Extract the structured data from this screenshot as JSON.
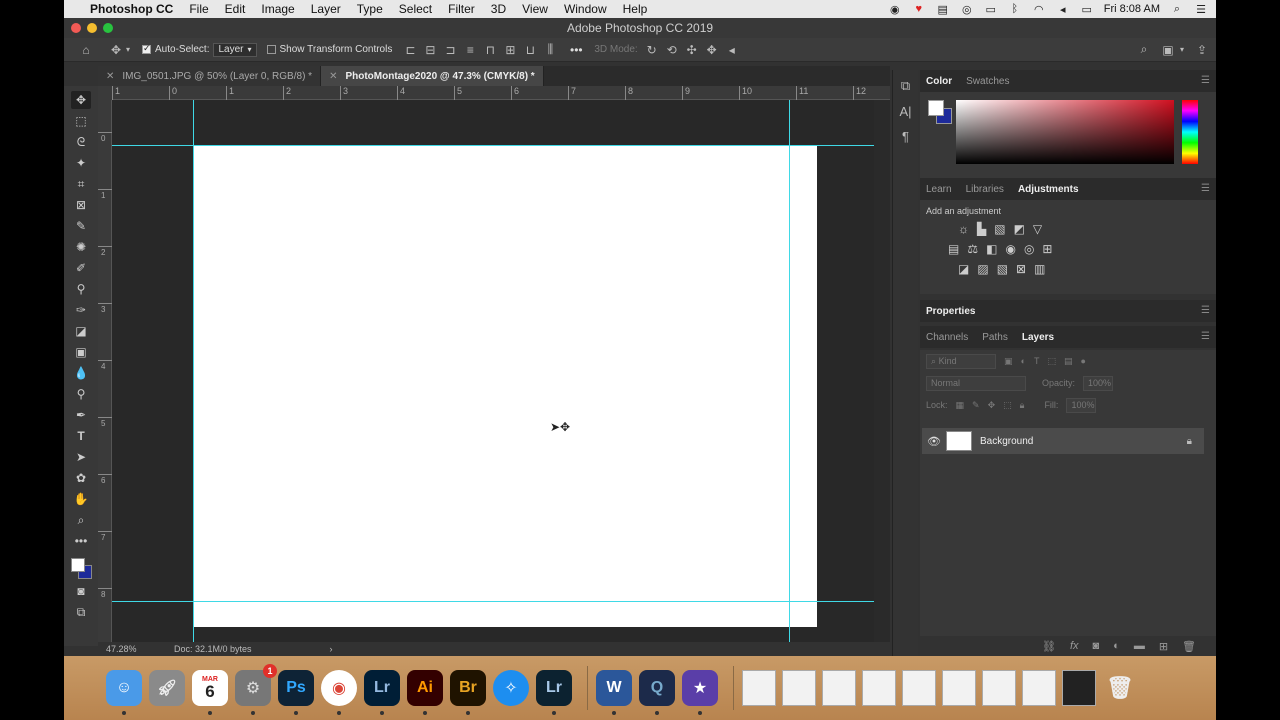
{
  "menubar": {
    "app": "Photoshop CC",
    "items": [
      "File",
      "Edit",
      "Image",
      "Layer",
      "Type",
      "Select",
      "Filter",
      "3D",
      "View",
      "Window",
      "Help"
    ],
    "clock": "Fri 8:08 AM"
  },
  "window": {
    "title": "Adobe Photoshop CC 2019"
  },
  "options": {
    "auto_select_label": "Auto-Select:",
    "auto_select_value": "Layer",
    "show_transform_label": "Show Transform Controls",
    "mode3d_label": "3D Mode:"
  },
  "tabs": [
    {
      "label": "IMG_0501.JPG @ 50% (Layer 0, RGB/8) *"
    },
    {
      "label": "PhotoMontage2020 @ 47.3% (CMYK/8) *"
    }
  ],
  "rulers": {
    "h_labels": [
      "1",
      "0",
      "1",
      "2",
      "3",
      "4",
      "5",
      "6",
      "7",
      "8",
      "9",
      "10",
      "11",
      "12"
    ],
    "v_labels": [
      "0",
      "1",
      "2",
      "3",
      "4",
      "5",
      "6",
      "7",
      "8"
    ]
  },
  "status": {
    "zoom": "47.28%",
    "doc": "Doc: 32.1M/0 bytes"
  },
  "color_panel": {
    "tabs": [
      "Color",
      "Swatches"
    ],
    "foreground": "#ffffff",
    "background": "#1d2a9a"
  },
  "adjustments_panel": {
    "tabs": [
      "Learn",
      "Libraries",
      "Adjustments"
    ],
    "hint": "Add an adjustment"
  },
  "properties_panel": {
    "title": "Properties"
  },
  "layers_panel": {
    "tabs": [
      "Channels",
      "Paths",
      "Layers"
    ],
    "kind_placeholder": "Kind",
    "blend_mode": "Normal",
    "opacity_label": "Opacity:",
    "opacity_value": "100%",
    "lock_label": "Lock:",
    "fill_label": "Fill:",
    "fill_value": "100%",
    "layers": [
      {
        "name": "Background",
        "visible": true,
        "locked": true
      }
    ]
  },
  "dock": {
    "calendar_month": "MAR",
    "calendar_day": "6",
    "prefs_badge": "1",
    "apps": [
      "Finder",
      "Launchpad",
      "Calendar",
      "System Preferences",
      "Photoshop",
      "Chrome",
      "Lightroom",
      "Illustrator",
      "Bridge",
      "Safari",
      "Lightroom Classic",
      "Word",
      "QuickTime",
      "iMovie"
    ]
  }
}
